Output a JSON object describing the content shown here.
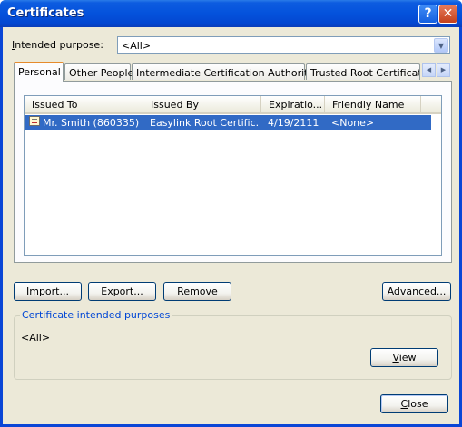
{
  "window": {
    "title": "Certificates",
    "help_glyph": "?",
    "close_glyph": "✕"
  },
  "purpose": {
    "label_accel": "I",
    "label_rest": "ntended purpose:",
    "value": "<All>"
  },
  "tabs": [
    {
      "label": "Personal",
      "active": true
    },
    {
      "label": "Other People",
      "active": false
    },
    {
      "label": "Intermediate Certification Authorities",
      "active": false
    },
    {
      "label": "Trusted Root Certification",
      "active": false
    }
  ],
  "tab_scroll": {
    "left": "◀",
    "right": "▶"
  },
  "table": {
    "columns": [
      "Issued To",
      "Issued By",
      "Expiratio...",
      "Friendly Name"
    ],
    "rows": [
      {
        "issued_to": "Mr. Smith (860335)",
        "issued_by": "Easylink Root Certific...",
        "expiration": "4/19/2111",
        "friendly_name": "<None>"
      }
    ]
  },
  "buttons": {
    "import_accel": "I",
    "import_rest": "mport...",
    "export_accel": "E",
    "export_rest": "xport...",
    "remove_accel": "R",
    "remove_rest": "emove",
    "advanced_accel": "A",
    "advanced_rest": "dvanced...",
    "view_accel": "V",
    "view_rest": "iew",
    "close_accel": "C",
    "close_rest": "lose"
  },
  "purposes_group": {
    "label": "Certificate intended purposes",
    "value": "<All>"
  },
  "colors": {
    "titlebar": "#0452dc",
    "selection": "#316ac5",
    "dialog_bg": "#ece9d8",
    "group_label": "#0046d5",
    "active_tab_accent": "#e68b2c"
  },
  "icons": {
    "combo_arrow": "chevron-down-icon",
    "certificate": "certificate-icon"
  }
}
